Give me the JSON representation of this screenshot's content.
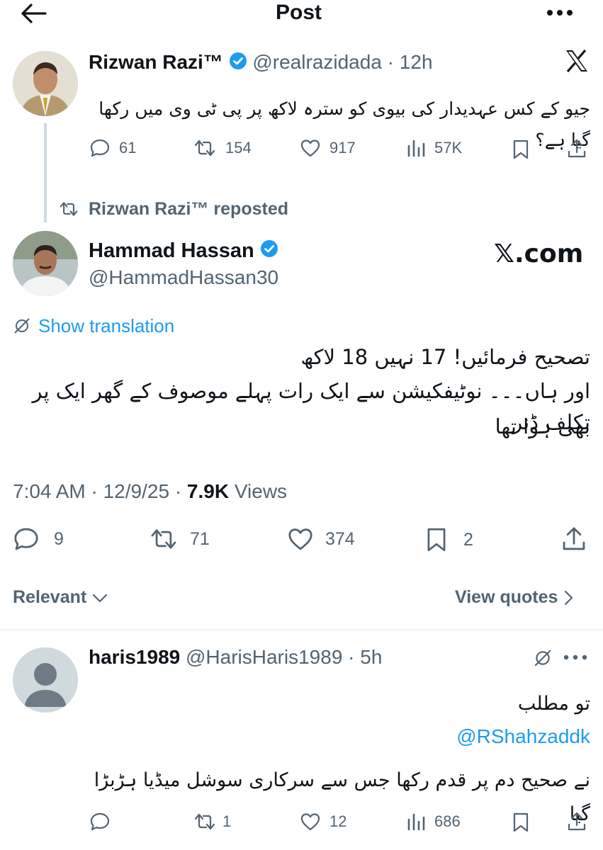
{
  "header": {
    "title": "Post"
  },
  "post1": {
    "name": "Rizwan Razi™",
    "handle": "@realrazidada",
    "time": "12h",
    "text": "جیو کے کس عہدیدار کی بیوی کو سترہ لاکھ پر پی ٹی وی میں رکھا گیا ہے؟",
    "replies": "61",
    "reposts": "154",
    "likes": "917",
    "views": "57K"
  },
  "repost_banner": "Rizwan Razi™ reposted",
  "main_post": {
    "name": "Hammad Hassan",
    "handle": "@HammadHassan30",
    "watermark": "𝕏.com",
    "show_translation": "Show translation",
    "line1": "تصحیح فرمائیں! 17 نہیں 18 لاکھ",
    "line2": "اور ہاں۔۔۔ نوٹیفکیشن سے ایک رات پہلے موصوف کے گھر ایک پر تکلف ڈنر",
    "line3": "بھی ہوا تھا",
    "meta_time": "7:04 AM · 12/9/25 · ",
    "meta_views_count": "7.9K",
    "meta_views_label": " Views",
    "replies": "9",
    "reposts": "71",
    "likes": "374",
    "bookmarks": "2"
  },
  "filter": {
    "relevant": "Relevant",
    "view_quotes": "View quotes"
  },
  "reply": {
    "name": "haris1989",
    "handle": "@HarisHaris1989",
    "time": "5h",
    "line1": "تو مطلب",
    "mention": "@RShahzaddk",
    "line2": "نے صحیح دم پر قدم رکھا جس سے سرکاری سوشل میڈیا ہڑبڑا گیا",
    "replies": "",
    "reposts": "1",
    "likes": "12",
    "views": "686"
  },
  "colors": {
    "accent": "#1d9bf0",
    "muted": "#536471",
    "divider": "#eff3f4"
  }
}
